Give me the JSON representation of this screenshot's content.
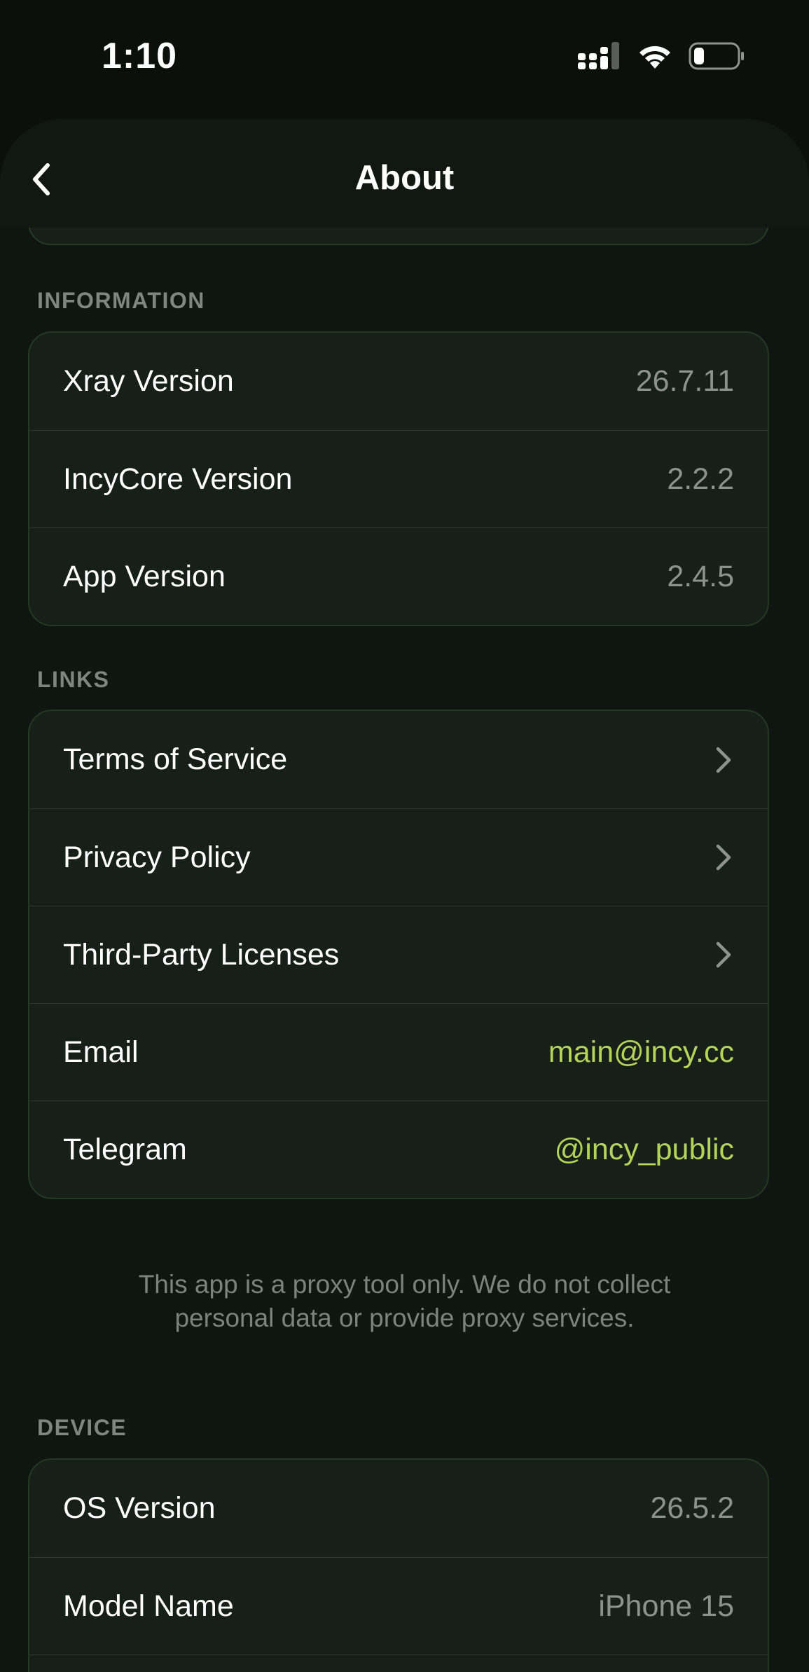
{
  "status_bar": {
    "time": "1:10"
  },
  "nav": {
    "title": "About",
    "back_icon": "chevron-left-icon"
  },
  "sections": {
    "information": {
      "header": "INFORMATION",
      "rows": [
        {
          "label": "Xray Version",
          "value": "26.7.11"
        },
        {
          "label": "IncyCore Version",
          "value": "2.2.2"
        },
        {
          "label": "App Version",
          "value": "2.4.5"
        }
      ]
    },
    "links": {
      "header": "LINKS",
      "rows": [
        {
          "label": "Terms of Service"
        },
        {
          "label": "Privacy Policy"
        },
        {
          "label": "Third-Party Licenses"
        },
        {
          "label": "Email",
          "value": "main@incy.cc"
        },
        {
          "label": "Telegram",
          "value": "@incy_public"
        }
      ]
    },
    "device": {
      "header": "DEVICE",
      "rows": [
        {
          "label": "OS Version",
          "value": "26.5.2"
        },
        {
          "label": "Model Name",
          "value": "iPhone 15"
        }
      ]
    }
  },
  "disclaimer": {
    "line1": "This app is a proxy tool only. We do not collect",
    "line2": "personal data or provide proxy services."
  },
  "colors": {
    "background": "#0b100c",
    "card": "#172018",
    "card_border": "#243822",
    "accent": "#b4d35a",
    "secondary_text": "#8d928c"
  }
}
